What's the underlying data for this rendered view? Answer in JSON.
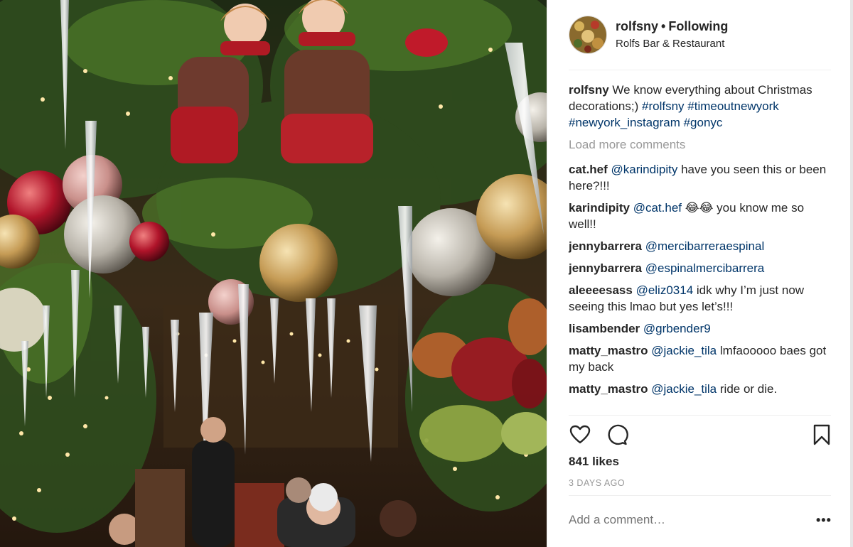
{
  "post": {
    "username": "rolfsny",
    "follow_status": "Following",
    "location": "Rolfs Bar & Restaurant"
  },
  "caption": {
    "user": "rolfsny",
    "text": "We know everything about Christmas decorations;)",
    "hashtags": [
      "#rolfsny",
      "#timeoutnewyork",
      "#newyork_instagram",
      "#gonyc"
    ]
  },
  "load_more": "Load more comments",
  "comments": [
    {
      "user": "cat.hef",
      "mention": "@karindipity",
      "text": "have you seen this or been here?!!!"
    },
    {
      "user": "karindipity",
      "mention": "@cat.hef",
      "text": "😂😂 you know me so well!!"
    },
    {
      "user": "jennybarrera",
      "mention": "@mercibarreraespinal",
      "text": ""
    },
    {
      "user": "jennybarrera",
      "mention": "@espinalmercibarrera",
      "text": ""
    },
    {
      "user": "aleeeesass",
      "mention": "@eliz0314",
      "text": "idk why I’m just now seeing this lmao but yes let’s!!!"
    },
    {
      "user": "lisambender",
      "mention": "@grbender9",
      "text": ""
    },
    {
      "user": "matty_mastro",
      "mention": "@jackie_tila",
      "text": "lmfaooooo baes got my back"
    },
    {
      "user": "matty_mastro",
      "mention": "@jackie_tila",
      "text": "ride or die."
    }
  ],
  "actions": {
    "like_icon": "heart-icon",
    "comment_icon": "comment-bubble-icon",
    "save_icon": "bookmark-icon"
  },
  "likes": "841 likes",
  "timestamp": "3 DAYS AGO",
  "add_comment_placeholder": "Add a comment…",
  "more_options": "•••",
  "colors": {
    "text": "#262626",
    "muted": "#999999",
    "link": "#003569",
    "border": "#efefef"
  }
}
